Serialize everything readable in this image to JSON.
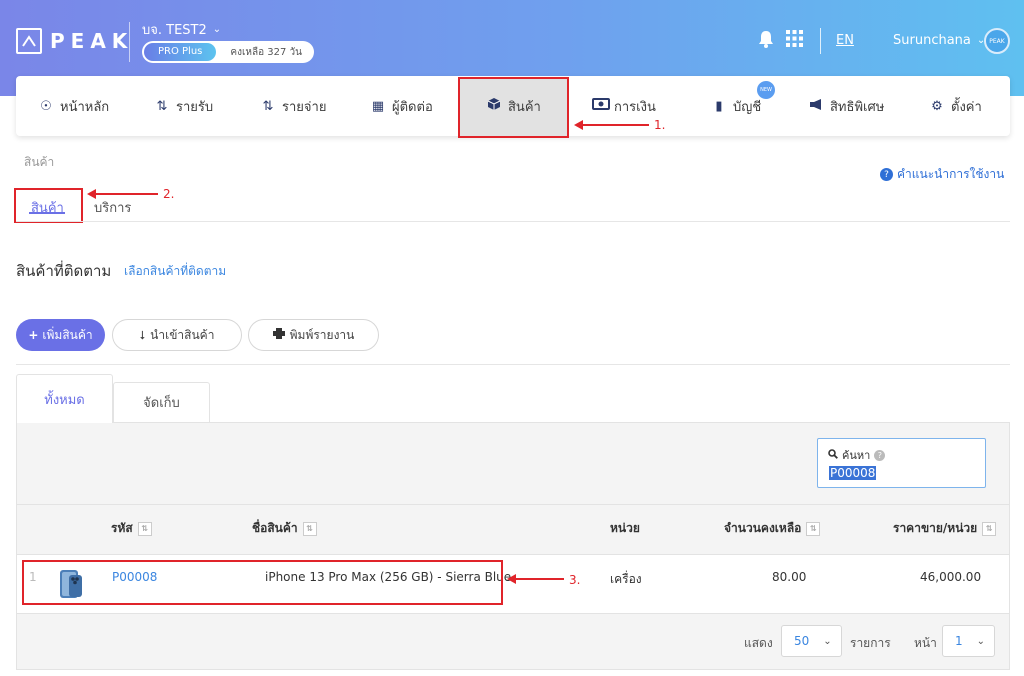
{
  "header": {
    "logo_text": "PEAK",
    "company": "บจ. TEST2",
    "plan": "PRO Plus",
    "days_left": "คงเหลือ 327 วัน",
    "lang": "EN",
    "user": "Surunchana",
    "avatar_text": "PEAK"
  },
  "menu": {
    "items": [
      {
        "label": "หน้าหลัก",
        "icon": "dashboard-icon"
      },
      {
        "label": "รายรับ",
        "icon": "income-icon"
      },
      {
        "label": "รายจ่าย",
        "icon": "expense-icon"
      },
      {
        "label": "ผู้ติดต่อ",
        "icon": "contacts-icon"
      },
      {
        "label": "สินค้า",
        "icon": "box-icon"
      },
      {
        "label": "การเงิน",
        "icon": "money-icon"
      },
      {
        "label": "บัญชี",
        "icon": "accounting-icon"
      },
      {
        "label": "สิทธิพิเศษ",
        "icon": "megaphone-icon"
      },
      {
        "label": "ตั้งค่า",
        "icon": "gear-icon"
      }
    ],
    "new_badge": "NEW"
  },
  "annotations": {
    "a1": "1.",
    "a2": "2.",
    "a3": "3."
  },
  "breadcrumb": "สินค้า",
  "help": "คำแนะนำการใช้งาน",
  "subtabs": {
    "product": "สินค้า",
    "service": "บริการ"
  },
  "section": {
    "title": "สินค้าที่ติดตาม",
    "link": "เลือกสินค้าที่ติดตาม"
  },
  "buttons": {
    "add": "เพิ่มสินค้า",
    "import": "นำเข้าสินค้า",
    "print": "พิมพ์รายงาน"
  },
  "panel_tabs": {
    "all": "ทั้งหมด",
    "archive": "จัดเก็บ"
  },
  "search": {
    "label": "ค้นหา",
    "value": "P00008"
  },
  "table": {
    "headers": {
      "code": "รหัส",
      "name": "ชื่อสินค้า",
      "unit": "หน่วย",
      "qty": "จำนวนคงเหลือ",
      "price": "ราคาขาย/หน่วย"
    },
    "rows": [
      {
        "index": "1",
        "code": "P00008",
        "name": "iPhone 13 Pro Max (256 GB) - Sierra Blue",
        "unit": "เครื่อง",
        "qty": "80.00",
        "price": "46,000.00"
      }
    ]
  },
  "pagination": {
    "show": "แสดง",
    "per_page": "50",
    "items": "รายการ",
    "page_label": "หน้า",
    "page": "1"
  },
  "colors": {
    "accent": "#6a70e6",
    "annotation": "#e0242a",
    "link": "#3b86e0"
  }
}
